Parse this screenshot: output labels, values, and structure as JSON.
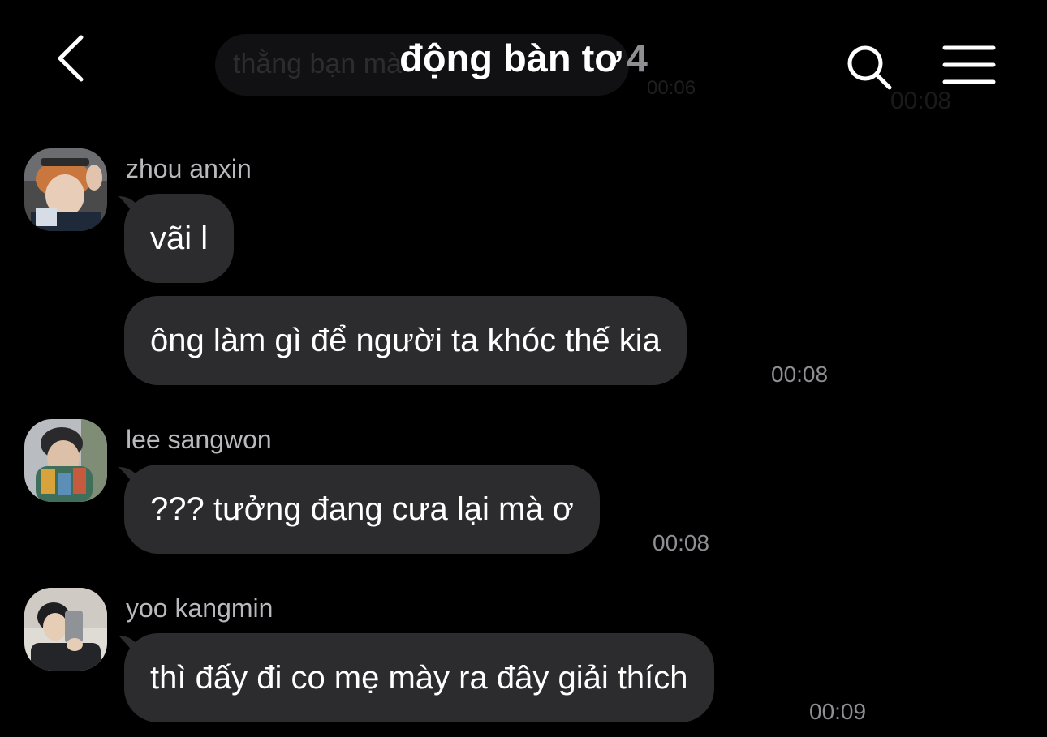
{
  "header": {
    "title": "động bàn tơ",
    "member_count": "4",
    "back_icon": "chevron-left-icon",
    "search_icon": "search-icon",
    "menu_icon": "hamburger-menu-icon"
  },
  "ghost": {
    "preview_text": "thằng bạn mà",
    "time_a": "00:06",
    "time_b": "00:08"
  },
  "messages": [
    {
      "sender": "zhou anxin",
      "bubbles": [
        {
          "text": "vãi l"
        },
        {
          "text": "ông làm gì để người ta khóc thế kia",
          "time": "00:08"
        }
      ]
    },
    {
      "sender": "lee sangwon",
      "bubbles": [
        {
          "text": "??? tưởng đang cưa lại mà ơ",
          "time": "00:08"
        }
      ]
    },
    {
      "sender": "yoo kangmin",
      "bubbles": [
        {
          "text": "thì đấy đi co mẹ mày ra đây giải thích",
          "time": "00:09"
        }
      ]
    }
  ],
  "colors": {
    "background": "#000000",
    "bubble": "#2c2c2e",
    "timestamp": "#8e8e93",
    "sender_name": "#b8b8bd"
  }
}
